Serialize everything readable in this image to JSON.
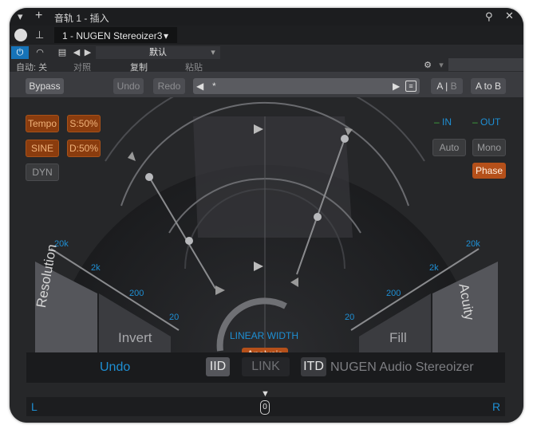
{
  "window": {
    "title": "音轨 1 - 插入"
  },
  "tab": {
    "label": "1 - NUGEN Stereoizer3"
  },
  "preset_bar": {
    "auto_label": "自动: 关",
    "compare_label": "对照",
    "copy_label": "复制",
    "paste_label": "粘贴",
    "preset_name": "默认"
  },
  "toolbar": {
    "bypass": "Bypass",
    "undo": "Undo",
    "redo": "Redo",
    "preset_field": "*",
    "ab_a": "A",
    "ab_sep": "|",
    "ab_b": "B",
    "a_to_b": "A to B"
  },
  "left_controls": {
    "tempo": "Tempo",
    "sync": "S:50%",
    "sine": "SINE",
    "depth": "D:50%",
    "dyn": "DYN"
  },
  "right_controls": {
    "in": "IN",
    "out": "OUT",
    "auto": "Auto",
    "mono": "Mono",
    "phase": "Phase"
  },
  "scale": {
    "left": [
      "20k",
      "2k",
      "200",
      "20"
    ],
    "right": [
      "20k",
      "2k",
      "200",
      "20"
    ]
  },
  "sectors": {
    "resolution": "Resolution",
    "invert": "Invert",
    "fill": "Fill",
    "acuity": "Acuity"
  },
  "center": {
    "title": "LINEAR WIDTH",
    "analysis": "Analysis"
  },
  "bottom": {
    "undo": "Undo",
    "iid": "IID",
    "link": "LINK",
    "itd": "ITD",
    "brand": "NUGEN Audio Stereoizer"
  },
  "balance": {
    "left": "L",
    "right": "R",
    "value": "0"
  },
  "colors": {
    "accent_blue": "#1e8fd4",
    "accent_orange": "#b5501a",
    "panel": "#262729"
  }
}
